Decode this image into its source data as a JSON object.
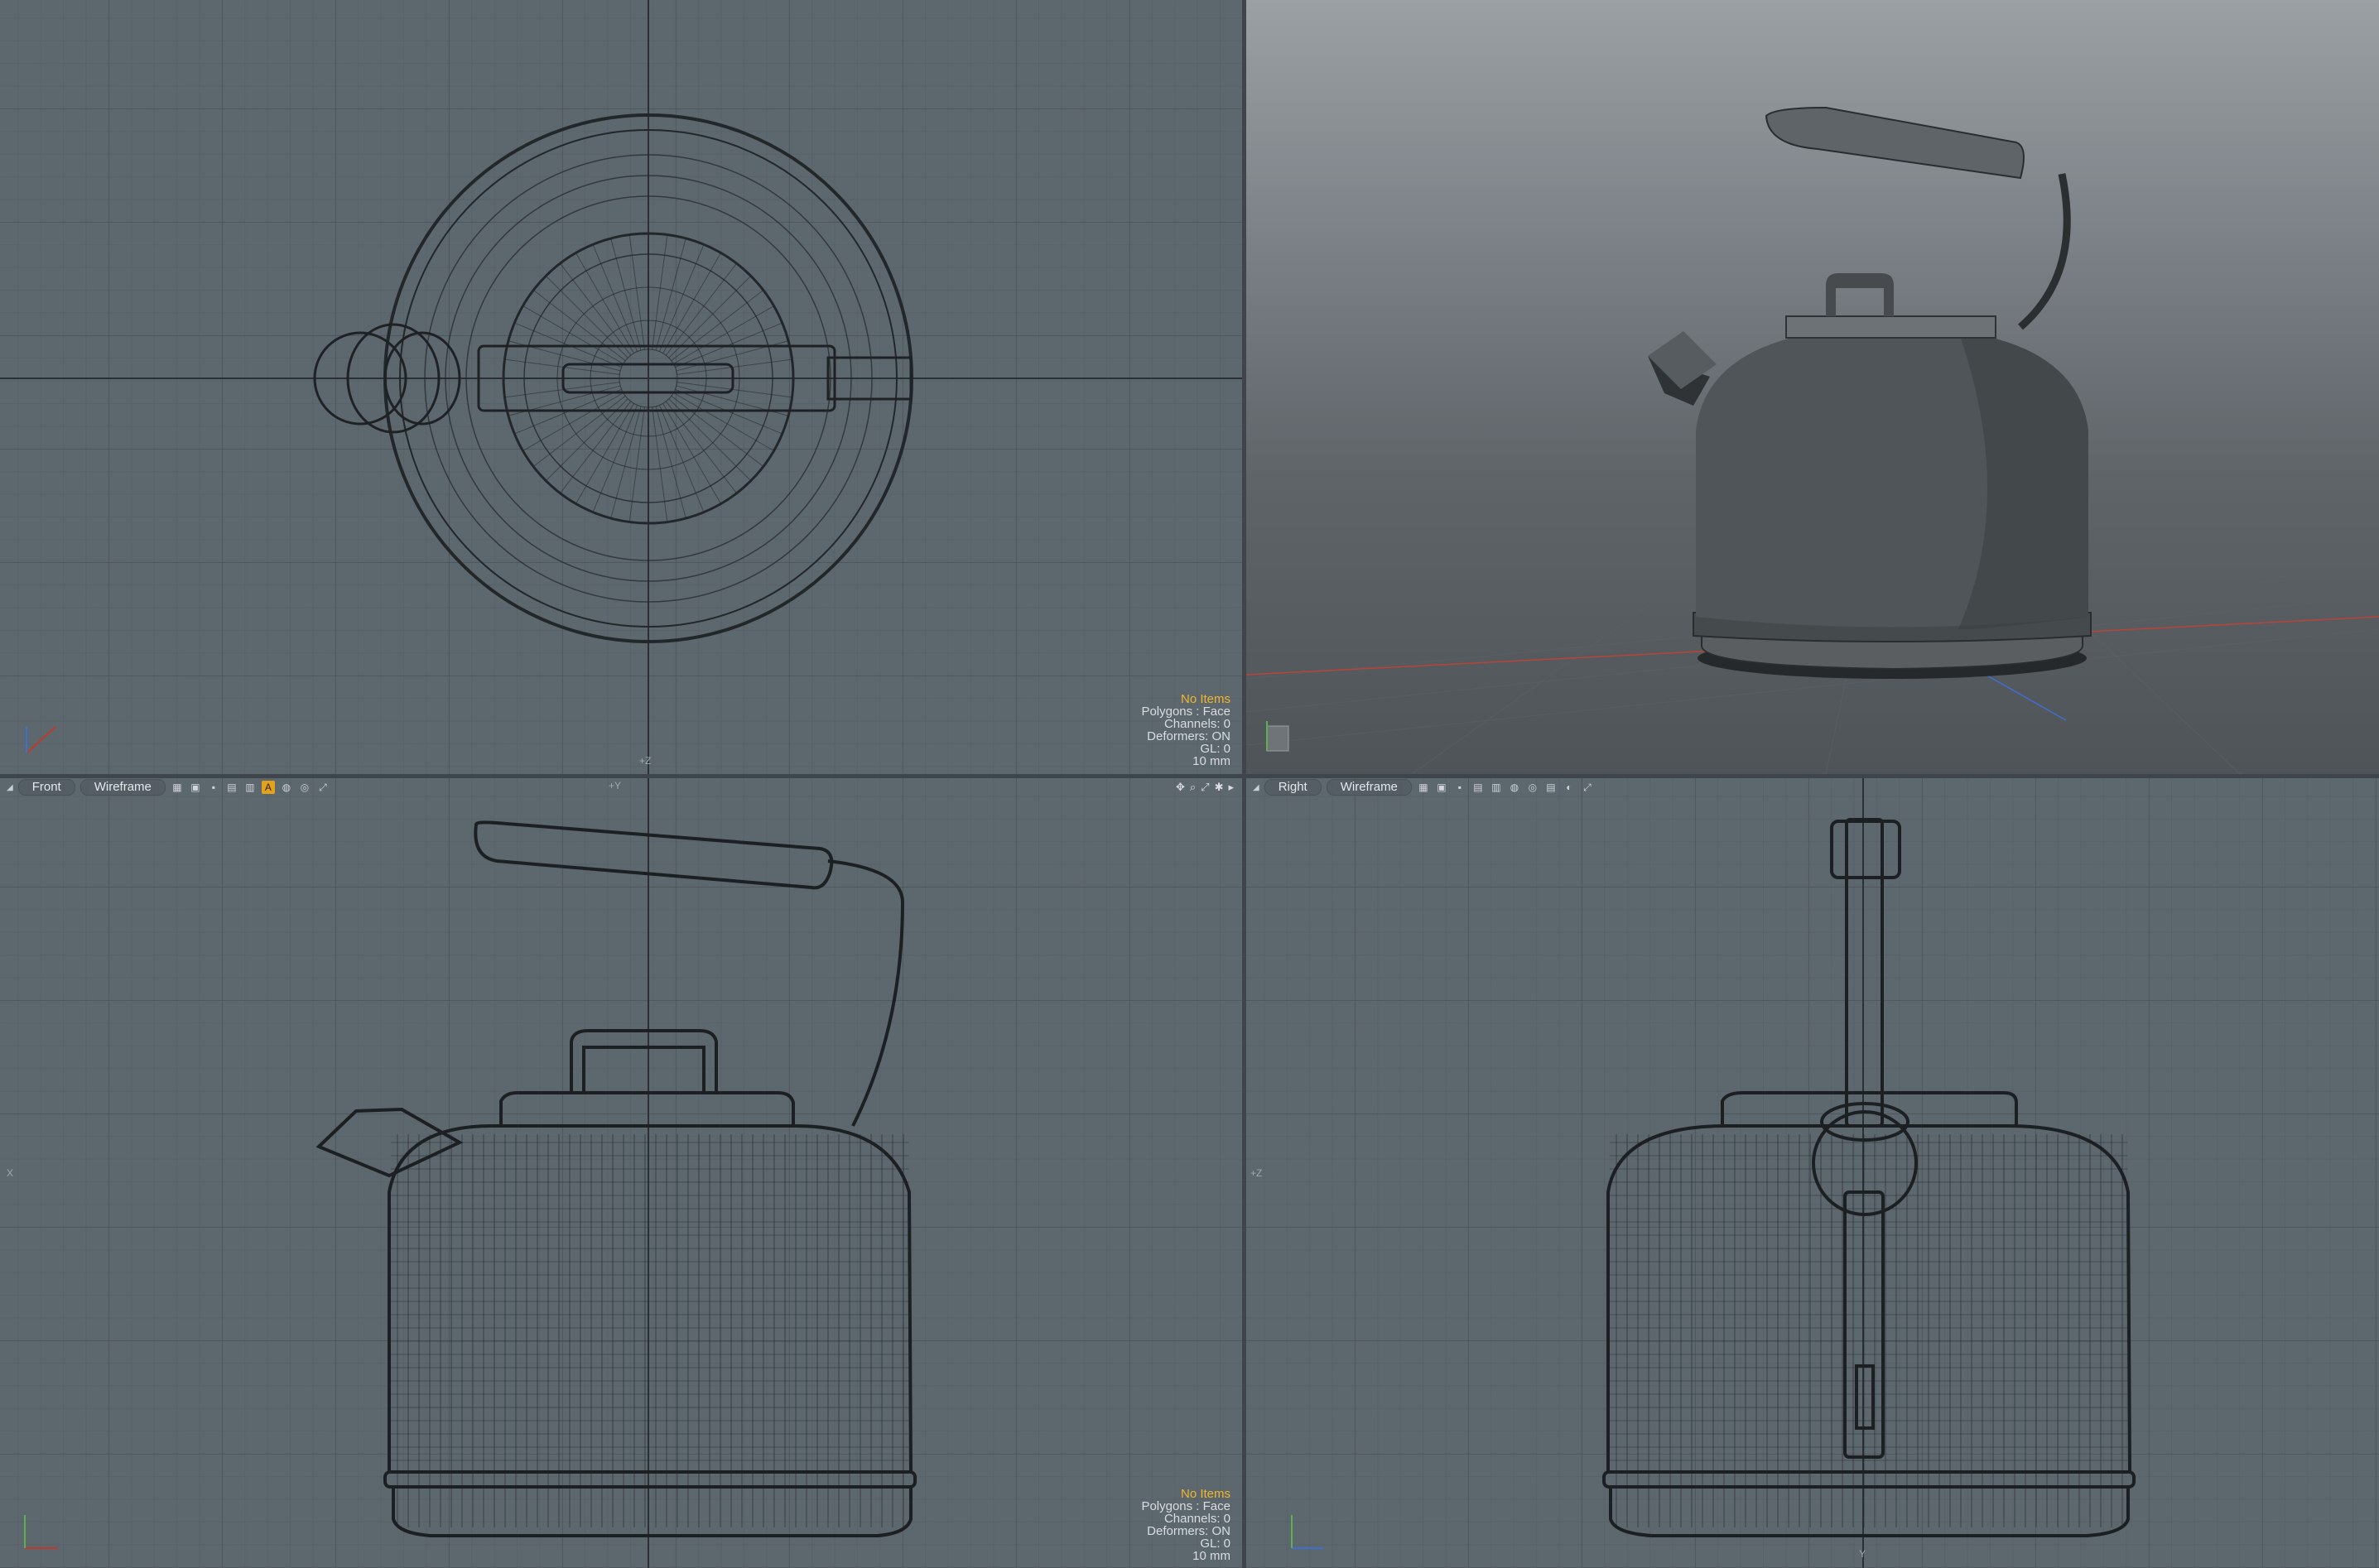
{
  "viewports": {
    "top": {
      "info": {
        "items": "No Items",
        "polygons": "Polygons : Face",
        "channels": "Channels: 0",
        "deformers": "Deformers: ON",
        "gl": "GL: 0",
        "scale": "10 mm"
      }
    },
    "front": {
      "view_label": "Front",
      "shading_label": "Wireframe",
      "info": {
        "items": "No Items",
        "polygons": "Polygons : Face",
        "channels": "Channels: 0",
        "deformers": "Deformers: ON",
        "gl": "GL: 0",
        "scale": "10 mm"
      }
    },
    "right": {
      "view_label": "Right",
      "shading_label": "Wireframe"
    }
  },
  "axis_labels": {
    "y": "Y",
    "z": "Z",
    "x": "X",
    "plus_y": "+Y",
    "plus_z": "+Z",
    "plus_x": "+X"
  },
  "colors": {
    "grid_bg": "#5d676e",
    "wire": "#1f2326",
    "info_highlight": "#f3b52a",
    "active_tool": "#e3a21a",
    "x_axis": "#c0392b",
    "y_axis": "#5fae4f",
    "z_axis": "#3f6fd0"
  },
  "icons": [
    "view-menu-triangle-icon",
    "grid-icon",
    "layout-icon",
    "select-icon",
    "wire-icon",
    "texture-icon",
    "light-icon",
    "active-tool-icon",
    "sphere-icon",
    "pan-icon",
    "zoom-icon",
    "fit-icon",
    "settings-icon"
  ]
}
